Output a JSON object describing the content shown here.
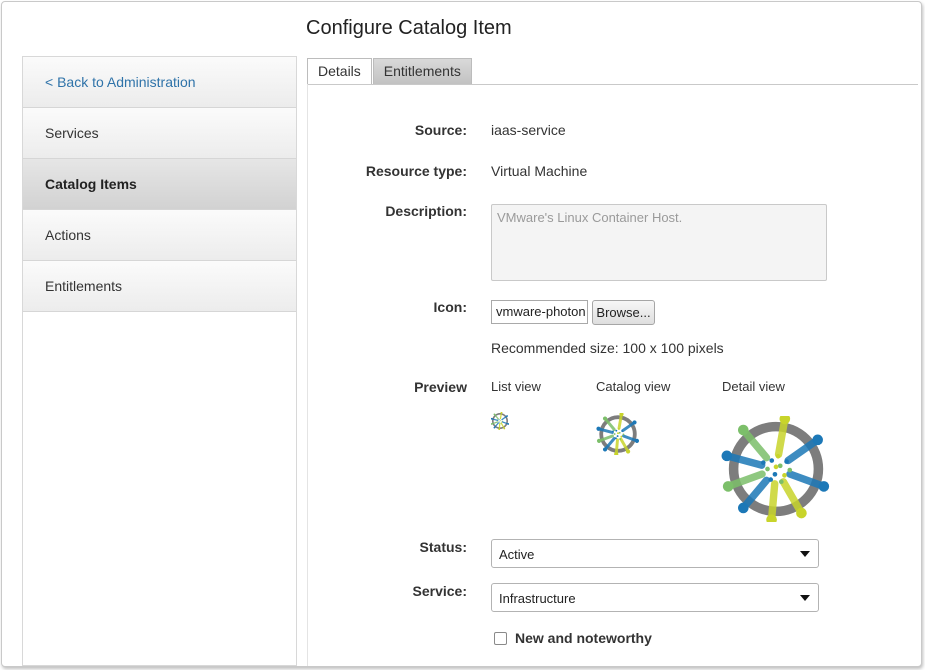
{
  "page": {
    "title": "Configure Catalog Item"
  },
  "sidebar": {
    "items": [
      {
        "label": "< Back to Administration"
      },
      {
        "label": "Services"
      },
      {
        "label": "Catalog Items"
      },
      {
        "label": "Actions"
      },
      {
        "label": "Entitlements"
      }
    ],
    "active_index": 2
  },
  "tabs": [
    {
      "label": "Details",
      "active": true
    },
    {
      "label": "Entitlements",
      "active": false
    }
  ],
  "form": {
    "source": {
      "label": "Source:",
      "value": "iaas-service"
    },
    "resource_type": {
      "label": "Resource type:",
      "value": "Virtual Machine"
    },
    "description": {
      "label": "Description:",
      "value": "VMware's Linux Container Host."
    },
    "icon": {
      "label": "Icon:",
      "value": "vmware-photon",
      "browse_label": "Browse...",
      "hint": "Recommended size: 100 x 100 pixels"
    },
    "preview": {
      "label": "Preview",
      "list_view": "List view",
      "catalog_view": "Catalog view",
      "detail_view": "Detail view"
    },
    "status": {
      "label": "Status:",
      "value": "Active"
    },
    "service": {
      "label": "Service:",
      "value": "Infrastructure"
    },
    "new_and_noteworthy": {
      "label": "New and noteworthy",
      "checked": false
    }
  },
  "colors": {
    "link": "#2f73a9",
    "logo_ring": "#7d7d7d",
    "logo_blue": "#1c78b7",
    "logo_yellow": "#c8d42b",
    "logo_green": "#7cbf6a"
  }
}
